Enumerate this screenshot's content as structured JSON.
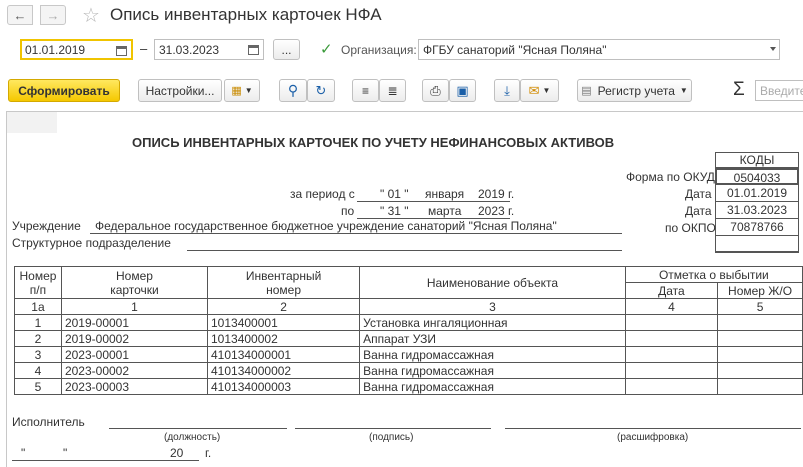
{
  "window": {
    "title": "Опись инвентарных карточек НФА"
  },
  "params": {
    "date_from": "01.01.2019",
    "date_to": "31.03.2023",
    "dash": "–",
    "more_label": "...",
    "org_label": "Организация:",
    "org_value": "ФГБУ санаторий \"Ясная Поляна\"",
    "org_checked": true
  },
  "toolbar": {
    "generate_label": "Сформировать",
    "settings_label": "Настройки...",
    "register_label": "Регистр учета",
    "search_placeholder": "Введите"
  },
  "report": {
    "title": "ОПИСЬ ИНВЕНТАРНЫХ КАРТОЧЕК ПО УЧЕТУ НЕФИНАНСОВЫХ АКТИВОВ",
    "codes_header": "КОДЫ",
    "okud_label": "Форма по ОКУД",
    "okud_value": "0504033",
    "date_label_1": "Дата",
    "date_value_1": "01.01.2019",
    "date_label_2": "Дата",
    "date_value_2": "31.03.2023",
    "okpo_label": "по ОКПО",
    "okpo_value": "70878766",
    "period_from_label": "за период с",
    "period_from_day": "\" 01 \"",
    "period_from_month": "января",
    "period_from_year": "2019",
    "period_to_label": "по",
    "period_to_day": "\" 31 \"",
    "period_to_month": "марта",
    "period_to_year": "2023",
    "year_suffix_1": "г.",
    "year_suffix_2": "г.",
    "institution_label": "Учреждение",
    "institution_value": "Федеральное государственное бюджетное учреждение санаторий \"Ясная Поляна\"",
    "subdivision_label": "Структурное подразделение",
    "columns": {
      "num_1": "Номер",
      "num_2": "п/п",
      "card_1": "Номер",
      "card_2": "карточки",
      "inv_1": "Инвентарный",
      "inv_2": "номер",
      "name": "Наименование объекта",
      "disposal": "Отметка о выбытии",
      "date": "Дата",
      "jo": "Номер Ж/О"
    },
    "column_numbers": [
      "1а",
      "1",
      "2",
      "3",
      "4",
      "5"
    ],
    "rows": [
      {
        "n": "1",
        "card": "2019-00001",
        "inv": "1013400001",
        "name": "Установка ингаляционная",
        "date": "",
        "jo": ""
      },
      {
        "n": "2",
        "card": "2019-00002",
        "inv": "1013400002",
        "name": "Аппарат УЗИ",
        "date": "",
        "jo": ""
      },
      {
        "n": "3",
        "card": "2023-00001",
        "inv": "410134000001",
        "name": "Ванна гидромассажная",
        "date": "",
        "jo": ""
      },
      {
        "n": "4",
        "card": "2023-00002",
        "inv": "410134000002",
        "name": "Ванна гидромассажная",
        "date": "",
        "jo": ""
      },
      {
        "n": "5",
        "card": "2023-00003",
        "inv": "410134000003",
        "name": "Ванна гидромассажная",
        "date": "",
        "jo": ""
      }
    ],
    "executor_label": "Исполнитель",
    "position_caption": "(должность)",
    "signature_caption": "(подпись)",
    "decode_caption": "(расшифровка)",
    "date_quote_1": "\"",
    "date_quote_2": "\"",
    "date_year": "20",
    "date_suffix": "г."
  }
}
